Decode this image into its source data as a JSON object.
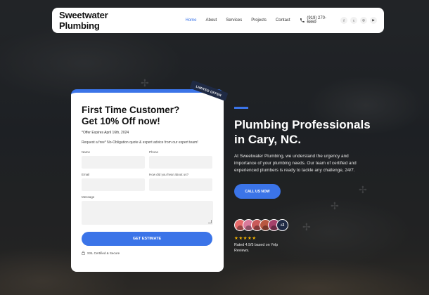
{
  "nav": {
    "brand": "Sweetwater Plumbing",
    "items": [
      {
        "label": "Home",
        "active": true
      },
      {
        "label": "About",
        "active": false
      },
      {
        "label": "Services",
        "active": false
      },
      {
        "label": "Projects",
        "active": false
      },
      {
        "label": "Contact",
        "active": false
      }
    ],
    "phone": "(919) 270-6869",
    "phone_icon": "phone-icon",
    "socials": [
      {
        "icon": "facebook-icon",
        "glyph": "f"
      },
      {
        "icon": "twitter-icon",
        "glyph": "t"
      },
      {
        "icon": "instagram-icon",
        "glyph": "◎"
      },
      {
        "icon": "youtube-icon",
        "glyph": "▶"
      }
    ]
  },
  "form": {
    "ribbon": "LIMITED OFFER",
    "title_line1": "First Time Customer?",
    "title_line2": "Get 10% Off now!",
    "offer_expiry": "*Offer Expires April 16th, 2024",
    "request_text": "Request a free* No-Obligation quote & expert advice from our expert team!",
    "fields": {
      "name_label": "Name",
      "phone_label": "Phone",
      "email_label": "Email",
      "referral_label": "How did you hear about us?",
      "message_label": "Message"
    },
    "submit_label": "GET ESTIMATE",
    "ssl_text": "SSL Certified & Secure"
  },
  "hero": {
    "title_line1": "Plumbing Professionals",
    "title_line2": "in Cary, NC.",
    "description": "At Sweetwater Plumbing, we understand the urgency and importance of your plumbing needs. Our team of certified and experienced plumbers is ready to tackle any challenge, 24/7.",
    "cta_label": "CALL US NOW",
    "extra_reviewers": "+2",
    "stars": "★★★★★",
    "rating_text": "Rated 4.9/5 based on Yelp Reviews."
  },
  "colors": {
    "accent": "#3b74e8",
    "dark_badge": "#1f2a44",
    "star": "#f5b400",
    "avatar_colors": [
      "#e66b6b",
      "#d97a9b",
      "#c95a5a",
      "#b8573f",
      "#a5416b"
    ]
  }
}
